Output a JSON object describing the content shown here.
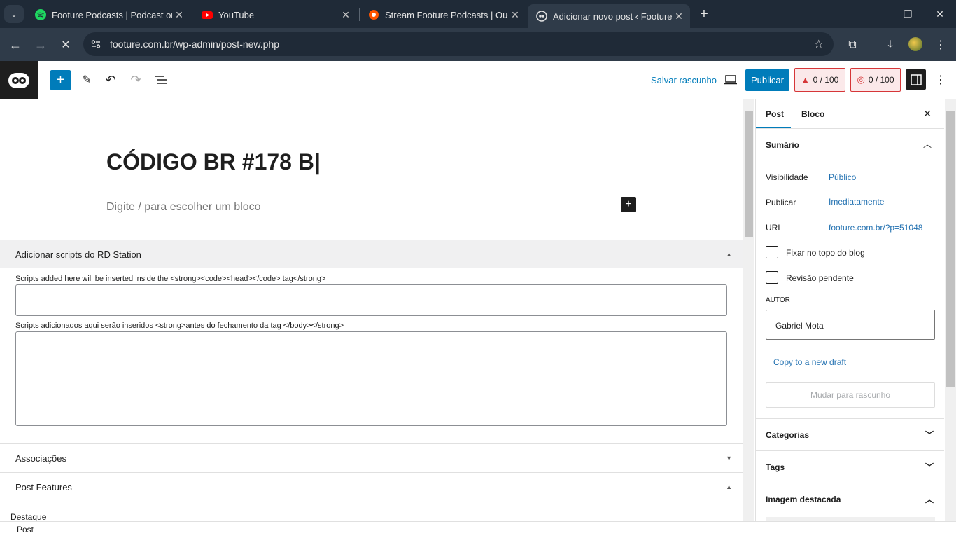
{
  "browser": {
    "tabs": [
      {
        "title": "Footure Podcasts | Podcast on S",
        "icon": "spotify-icon",
        "color": "#1ed760"
      },
      {
        "title": "YouTube",
        "icon": "youtube-icon",
        "color": "#ff0000"
      },
      {
        "title": "Stream Footure Podcasts | Ouça",
        "icon": "soundcloud-icon",
        "color": "#ff5500"
      },
      {
        "title": "Adicionar novo post ‹ Footure -",
        "icon": "footure-icon",
        "color": "#ffffff"
      }
    ],
    "new_tab": "+",
    "url": "footure.com.br/wp-admin/post-new.php"
  },
  "toolbar": {
    "save_draft": "Salvar rascunho",
    "publish": "Publicar",
    "score1": "0 / 100",
    "score2": "0 / 100"
  },
  "editor": {
    "title": "CÓDIGO BR #178 B|",
    "placeholder": "Digite / para escolher um bloco"
  },
  "meta": {
    "rd_title": "Adicionar scripts do RD Station",
    "head_label": "Scripts added here will be inserted inside the <strong><code><head></code> tag</strong>",
    "body_label": "Scripts adicionados aqui serão inseridos <strong>antes do fechamento da tag </body></strong>",
    "assoc_title": "Associações",
    "features_title": "Post Features",
    "destaque": "Destaque"
  },
  "sidebar": {
    "tab_post": "Post",
    "tab_block": "Bloco",
    "summary": "Sumário",
    "visibility_label": "Visibilidade",
    "visibility_value": "Público",
    "publish_label": "Publicar",
    "publish_value": "Imediatamente",
    "url_label": "URL",
    "url_value": "footure.com.br/?p=51048",
    "sticky": "Fixar no topo do blog",
    "pending": "Revisão pendente",
    "author_label": "AUTOR",
    "author_value": "Gabriel Mota",
    "copy_draft": "Copy to a new draft",
    "switch_draft": "Mudar para rascunho",
    "categories": "Categorias",
    "tags": "Tags",
    "featured_image": "Imagem destacada"
  },
  "footer": {
    "breadcrumb": "Post"
  },
  "colors": {
    "accent": "#007cba",
    "browser_dark": "#1f2a37"
  }
}
